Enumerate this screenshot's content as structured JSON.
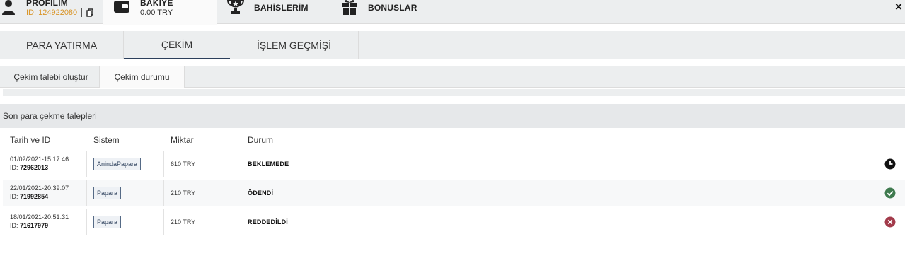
{
  "nav": {
    "profile": {
      "title": "PROFİLİM",
      "id_text": "ID: 124922080"
    },
    "balance": {
      "title": "BAKİYE",
      "amount": "0.00 TRY"
    },
    "bets": {
      "title": "BAHİSLERİM"
    },
    "bonuses": {
      "title": "BONUSLAR"
    },
    "close_label": "×"
  },
  "main_tabs": [
    {
      "label": "PARA YATIRMA"
    },
    {
      "label": "ÇEKİM"
    },
    {
      "label": "İŞLEM GEÇMİŞİ"
    }
  ],
  "active_main_tab": "ÇEKİM",
  "sub_tabs": [
    {
      "label": "Çekim talebi oluştur"
    },
    {
      "label": "Çekim durumu"
    }
  ],
  "active_sub_tab": "Çekim durumu",
  "section_title": "Son para çekme talepleri",
  "table": {
    "headers": [
      "Tarih ve ID",
      "Sistem",
      "Miktar",
      "Durum"
    ],
    "rows": [
      {
        "date": "01/02/2021-15:17:46",
        "id_label": "ID:",
        "id": "72962013",
        "system": "AnindaPapara",
        "amount": "610 TRY",
        "status": "BEKLEMEDE",
        "status_icon": "clock-icon"
      },
      {
        "date": "22/01/2021-20:39:07",
        "id_label": "ID:",
        "id": "71992854",
        "system": "Papara",
        "amount": "210 TRY",
        "status": "ÖDENDİ",
        "status_icon": "check-icon"
      },
      {
        "date": "18/01/2021-20:51:31",
        "id_label": "ID:",
        "id": "71617979",
        "system": "Papara",
        "amount": "210 TRY",
        "status": "REDDEDİLDİ",
        "status_icon": "x-circle-icon"
      }
    ]
  },
  "colors": {
    "accent_navy": "#2c3f5b",
    "id_orange": "#d9962a",
    "paid_green": "#3f7a4f",
    "rejected_red": "#a23a4a",
    "pending_dark": "#111111"
  }
}
